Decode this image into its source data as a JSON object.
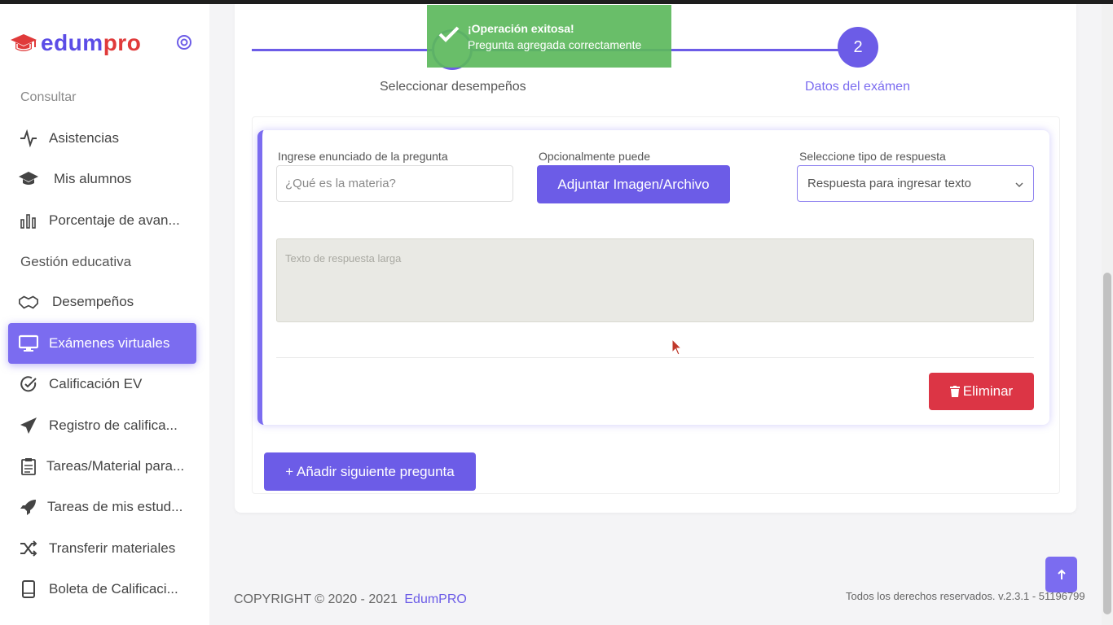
{
  "app": {
    "logo_name": "edumpro",
    "brand_colors": {
      "primary": "#6c5ce7",
      "accent": "#e03a3a"
    }
  },
  "sidebar": {
    "sections": [
      {
        "label": "Consultar",
        "items": [
          {
            "label": "Asistencias",
            "icon": "activity-icon"
          },
          {
            "label": "Mis alumnos",
            "icon": "graduation-cap-icon"
          },
          {
            "label": "Porcentaje de avan...",
            "icon": "bar-chart-icon"
          }
        ]
      },
      {
        "label": "Gestión educativa",
        "items": [
          {
            "label": "Desempeños",
            "icon": "handshake-icon"
          },
          {
            "label": "Exámenes virtuales",
            "icon": "monitor-icon",
            "active": true
          },
          {
            "label": "Calificación EV",
            "icon": "check-circle-icon"
          },
          {
            "label": "Registro de califica...",
            "icon": "paper-plane-icon"
          },
          {
            "label": "Tareas/Material para...",
            "icon": "clipboard-list-icon"
          },
          {
            "label": "Tareas de mis estud...",
            "icon": "rocket-icon"
          },
          {
            "label": "Transferir materiales",
            "icon": "shuffle-icon"
          },
          {
            "label": "Boleta de Calificaci...",
            "icon": "book-icon"
          }
        ]
      }
    ]
  },
  "stepper": {
    "step1_label": "Seleccionar desempeños",
    "step2_number": "2",
    "step2_label": "Datos del exámen"
  },
  "question": {
    "statement_label": "Ingrese enunciado de la pregunta",
    "statement_placeholder": "¿Qué es la materia?",
    "attach_label": "Opcionalmente puede",
    "attach_button": "Adjuntar Imagen/Archivo",
    "answer_type_label": "Seleccione tipo de respuesta",
    "answer_type_value": "Respuesta para ingresar texto",
    "answer_placeholder": "Texto de respuesta larga",
    "delete_button": "Eliminar"
  },
  "actions": {
    "add_next_question": "+ Añadir siguiente pregunta"
  },
  "toast": {
    "title": "¡Operación exitosa!",
    "message": "Pregunta agregada correctamente"
  },
  "footer": {
    "copyright": "COPYRIGHT © 2020 - 2021",
    "brand_link": "EdumPRO",
    "rights": "Todos los derechos reservados. v.2.3.1 - 51196799"
  }
}
